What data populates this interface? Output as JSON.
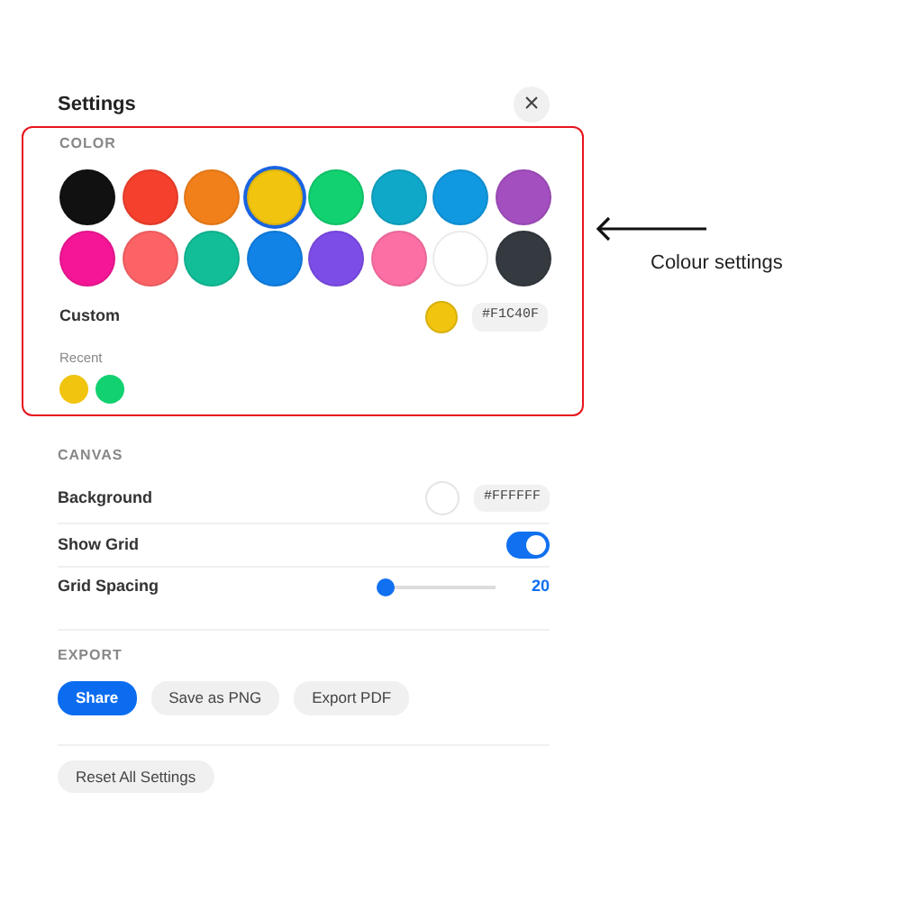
{
  "header": {
    "title": "Settings",
    "close": "×"
  },
  "color": {
    "heading": "COLOR",
    "highlighted": true,
    "swatches": [
      {
        "color": "#111111",
        "selected": false
      },
      {
        "color": "#f4402c",
        "selected": false
      },
      {
        "color": "#f2801a",
        "selected": false
      },
      {
        "color": "#f1c40f",
        "selected": true
      },
      {
        "color": "#12d170",
        "selected": false
      },
      {
        "color": "#10a8c8",
        "selected": false
      },
      {
        "color": "#1098e0",
        "selected": false
      },
      {
        "color": "#a44fc0",
        "selected": false
      },
      {
        "color": "#f41696",
        "selected": false
      },
      {
        "color": "#fc6366",
        "selected": false
      },
      {
        "color": "#12be98",
        "selected": false
      },
      {
        "color": "#1182e6",
        "selected": false
      },
      {
        "color": "#7d4de8",
        "selected": false
      },
      {
        "color": "#fc6fa5",
        "selected": false
      },
      {
        "color": "#ffffff",
        "selected": false
      },
      {
        "color": "#343a40",
        "selected": false
      }
    ],
    "custom": {
      "label": "Custom",
      "color": "#f1c40f",
      "hex": "#F1C40F"
    },
    "recent_label": "Recent",
    "recent": [
      {
        "color": "#f1c40f"
      },
      {
        "color": "#12d170"
      }
    ]
  },
  "canvas": {
    "heading": "CANVAS",
    "background": {
      "label": "Background",
      "color": "#ffffff",
      "hex": "#FFFFFF"
    },
    "show_grid_label": "Show Grid",
    "show_grid_on": true,
    "grid_spacing": {
      "label": "Grid Spacing",
      "level": 0,
      "value": "20"
    }
  },
  "export": {
    "heading": "EXPORT",
    "buttons": [
      {
        "label": "Share",
        "kind": "primary"
      },
      {
        "label": "Save as PNG",
        "kind": "secondary"
      },
      {
        "label": "Export PDF",
        "kind": "secondary"
      }
    ]
  },
  "reset_button": "Reset All Settings",
  "annotation": {
    "label": "Colour settings"
  }
}
